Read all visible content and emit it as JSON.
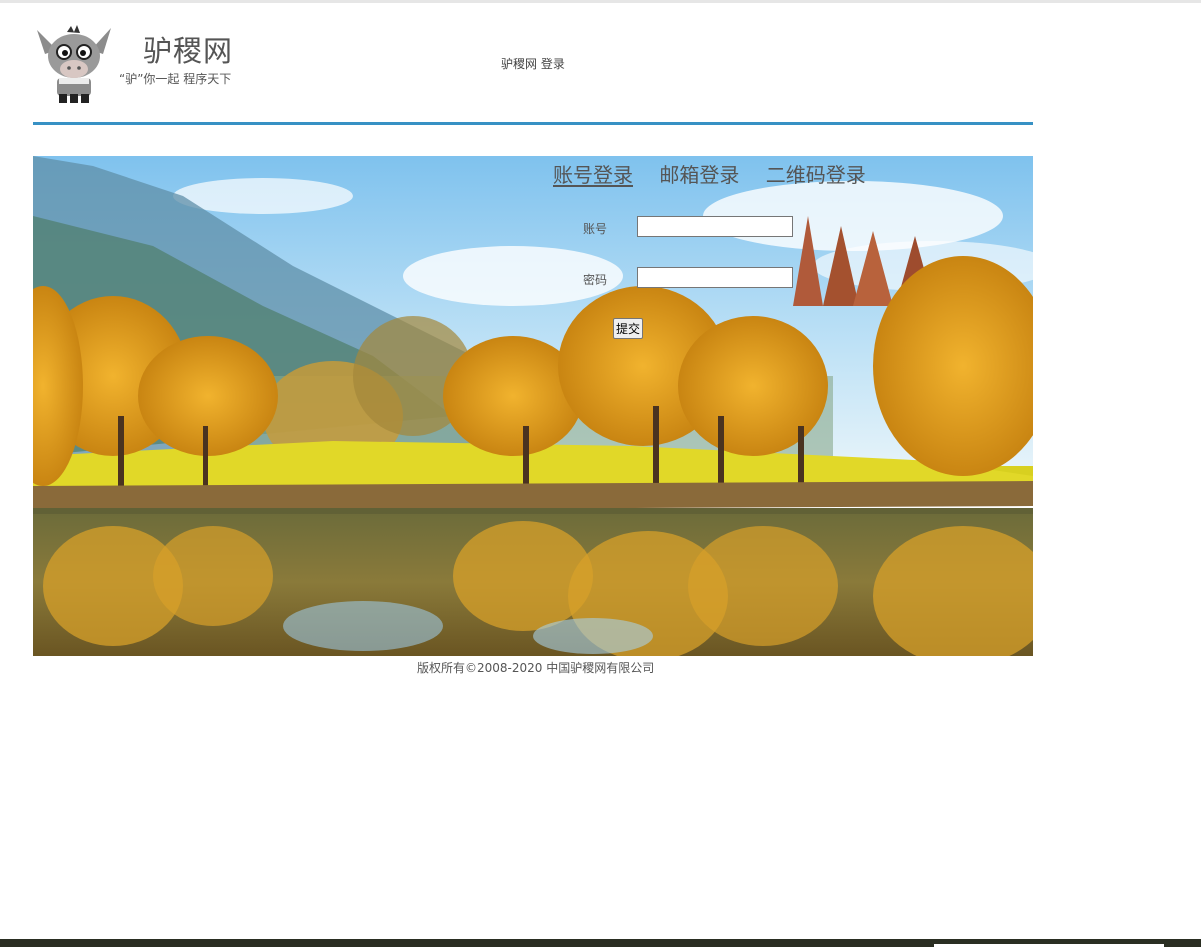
{
  "header": {
    "site_name": "驴稷网",
    "slogan": "“驴”你一起 程序天下",
    "nav": [
      "驴稷网",
      "登录"
    ],
    "logo_icon": "donkey-logo-icon"
  },
  "login": {
    "tabs": [
      {
        "label": "账号登录",
        "active": true
      },
      {
        "label": "邮箱登录",
        "active": false
      },
      {
        "label": "二维码登录",
        "active": false
      }
    ],
    "account_label": "账号",
    "account_value": "",
    "password_label": "密码",
    "password_value": "",
    "submit_label": "提交"
  },
  "footer": {
    "copyright": "版权所有©2008-2020 中国驴稷网有限公司"
  },
  "colors": {
    "accent_rule": "#3791c4",
    "text": "#555555"
  }
}
